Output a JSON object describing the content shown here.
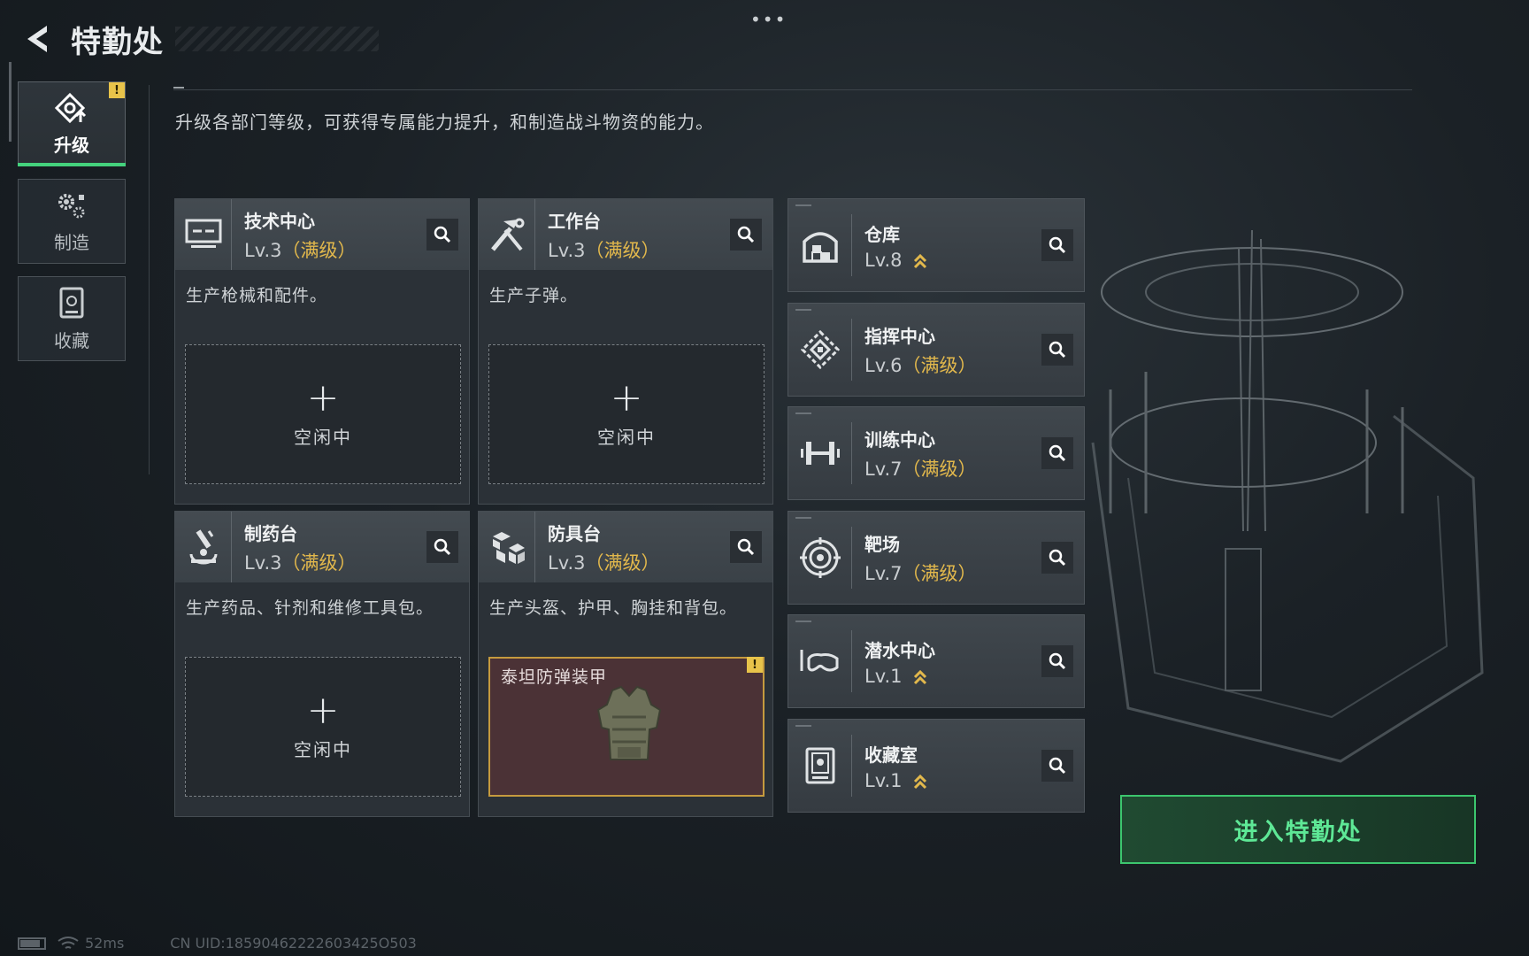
{
  "header": {
    "title": "特勤处"
  },
  "tabs": [
    {
      "label": "升级",
      "icon": "upgrade-icon",
      "active": true,
      "warning": "!"
    },
    {
      "label": "制造",
      "icon": "gears-icon",
      "active": false
    },
    {
      "label": "收藏",
      "icon": "collection-icon",
      "active": false
    }
  ],
  "description": "升级各部门等级，可获得专属能力提升，和制造战斗物资的能力。",
  "workshops": [
    {
      "name": "技术中心",
      "level": "Lv.3",
      "status": "（满级）",
      "desc": "生产枪械和配件。",
      "slot": {
        "plus": "+",
        "text": "空闲中"
      },
      "icon": "computer-icon"
    },
    {
      "name": "工作台",
      "level": "Lv.3",
      "status": "（满级）",
      "desc": "生产子弹。",
      "slot": {
        "plus": "+",
        "text": "空闲中"
      },
      "icon": "tools-icon"
    },
    {
      "name": "制药台",
      "level": "Lv.3",
      "status": "（满级）",
      "desc": "生产药品、针剂和维修工具包。",
      "slot": {
        "plus": "+",
        "text": "空闲中"
      },
      "icon": "microscope-icon"
    },
    {
      "name": "防具台",
      "level": "Lv.3",
      "status": "（满级）",
      "desc": "生产头盔、护甲、胸挂和背包。",
      "slot": {
        "item": "泰坦防弹装甲",
        "warning": "!"
      },
      "icon": "cubes-icon"
    }
  ],
  "facilities": [
    {
      "name": "仓库",
      "level": "Lv.8",
      "status": "",
      "upgradable": true,
      "icon": "warehouse-icon"
    },
    {
      "name": "指挥中心",
      "level": "Lv.6",
      "status": "（满级）",
      "upgradable": false,
      "icon": "command-icon"
    },
    {
      "name": "训练中心",
      "level": "Lv.7",
      "status": "（满级）",
      "upgradable": false,
      "icon": "dumbbell-icon"
    },
    {
      "name": "靶场",
      "level": "Lv.7",
      "status": "（满级）",
      "upgradable": false,
      "icon": "target-icon"
    },
    {
      "name": "潜水中心",
      "level": "Lv.1",
      "status": "",
      "upgradable": true,
      "icon": "diving-mask-icon"
    },
    {
      "name": "收藏室",
      "level": "Lv.1",
      "status": "",
      "upgradable": true,
      "icon": "collection-room-icon"
    }
  ],
  "enter_button": "进入特勤处",
  "footer": {
    "ping": "52ms",
    "uid": "CN UID:18590462222603425O503"
  },
  "colors": {
    "accent": "#44d27d",
    "max_level": "#e2b84c",
    "warning": "#e8c34a",
    "craft_bg": "#4b3236"
  }
}
